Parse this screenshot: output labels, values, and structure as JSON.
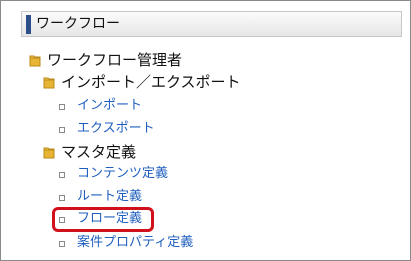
{
  "panel": {
    "title": "ワークフロー"
  },
  "tree": {
    "root": {
      "label": "ワークフロー管理者",
      "icon": "folder-icon"
    },
    "import_export": {
      "label": "インポート／エクスポート",
      "icon": "folder-icon",
      "items": [
        "インポート",
        "エクスポート"
      ]
    },
    "master": {
      "label": "マスタ定義",
      "icon": "folder-icon",
      "items": [
        "コンテンツ定義",
        "ルート定義",
        "フロー定義",
        "案件プロパティ定義"
      ]
    }
  },
  "highlight": {
    "target": "フロー定義",
    "color": "#d0101a"
  },
  "colors": {
    "link": "#1f5fbf",
    "header_accent": "#2e4f8a",
    "folder": "#e3b341"
  }
}
